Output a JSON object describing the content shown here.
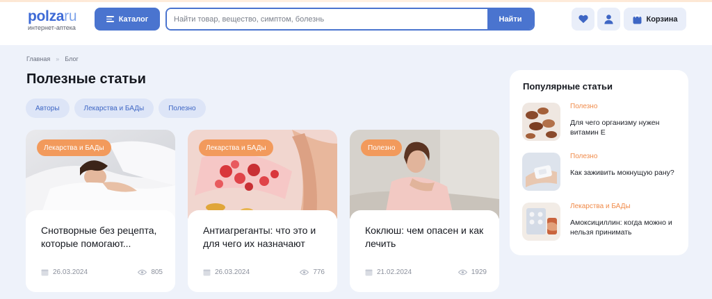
{
  "header": {
    "logo_main": "polza",
    "logo_tld": "ru",
    "logo_sub": "интернет-аптека",
    "catalog_label": "Каталог",
    "search_placeholder": "Найти товар, вещество, симптом, болезнь",
    "search_button": "Найти",
    "cart_label": "Корзина"
  },
  "breadcrumb": {
    "home": "Главная",
    "separator": "»",
    "current": "Блог"
  },
  "page_title": "Полезные статьи",
  "filters": [
    "Авторы",
    "Лекарства и БАДы",
    "Полезно"
  ],
  "articles": [
    {
      "tag": "Лекарства и БАДы",
      "title": "Снотворные без рецепта, которые помогают...",
      "date": "26.03.2024",
      "views": "805",
      "image": "sleeping-woman"
    },
    {
      "tag": "Лекарства и БАДы",
      "title": "Антиагреганты: что это и для чего их назначают",
      "date": "26.03.2024",
      "views": "776",
      "image": "blood-vessel"
    },
    {
      "tag": "Полезно",
      "title": "Коклюш: чем опасен и как лечить",
      "date": "21.02.2024",
      "views": "1929",
      "image": "coughing-woman"
    }
  ],
  "popular": {
    "title": "Популярные статьи",
    "items": [
      {
        "category": "Полезно",
        "title": "Для чего организму нужен витамин Е",
        "image": "nuts"
      },
      {
        "category": "Полезно",
        "title": "Как заживить мокнущую рану?",
        "image": "bandage"
      },
      {
        "category": "Лекарства и БАДы",
        "title": "Амоксициллин: когда можно и нельзя принимать",
        "image": "pills"
      }
    ]
  },
  "colors": {
    "accent": "#4a74cf",
    "tag": "#f29a5c",
    "category": "#f08a48",
    "background": "#eef2fa"
  },
  "icons": [
    "menu-icon",
    "heart-icon",
    "user-icon",
    "cart-icon",
    "calendar-icon",
    "eye-icon"
  ]
}
